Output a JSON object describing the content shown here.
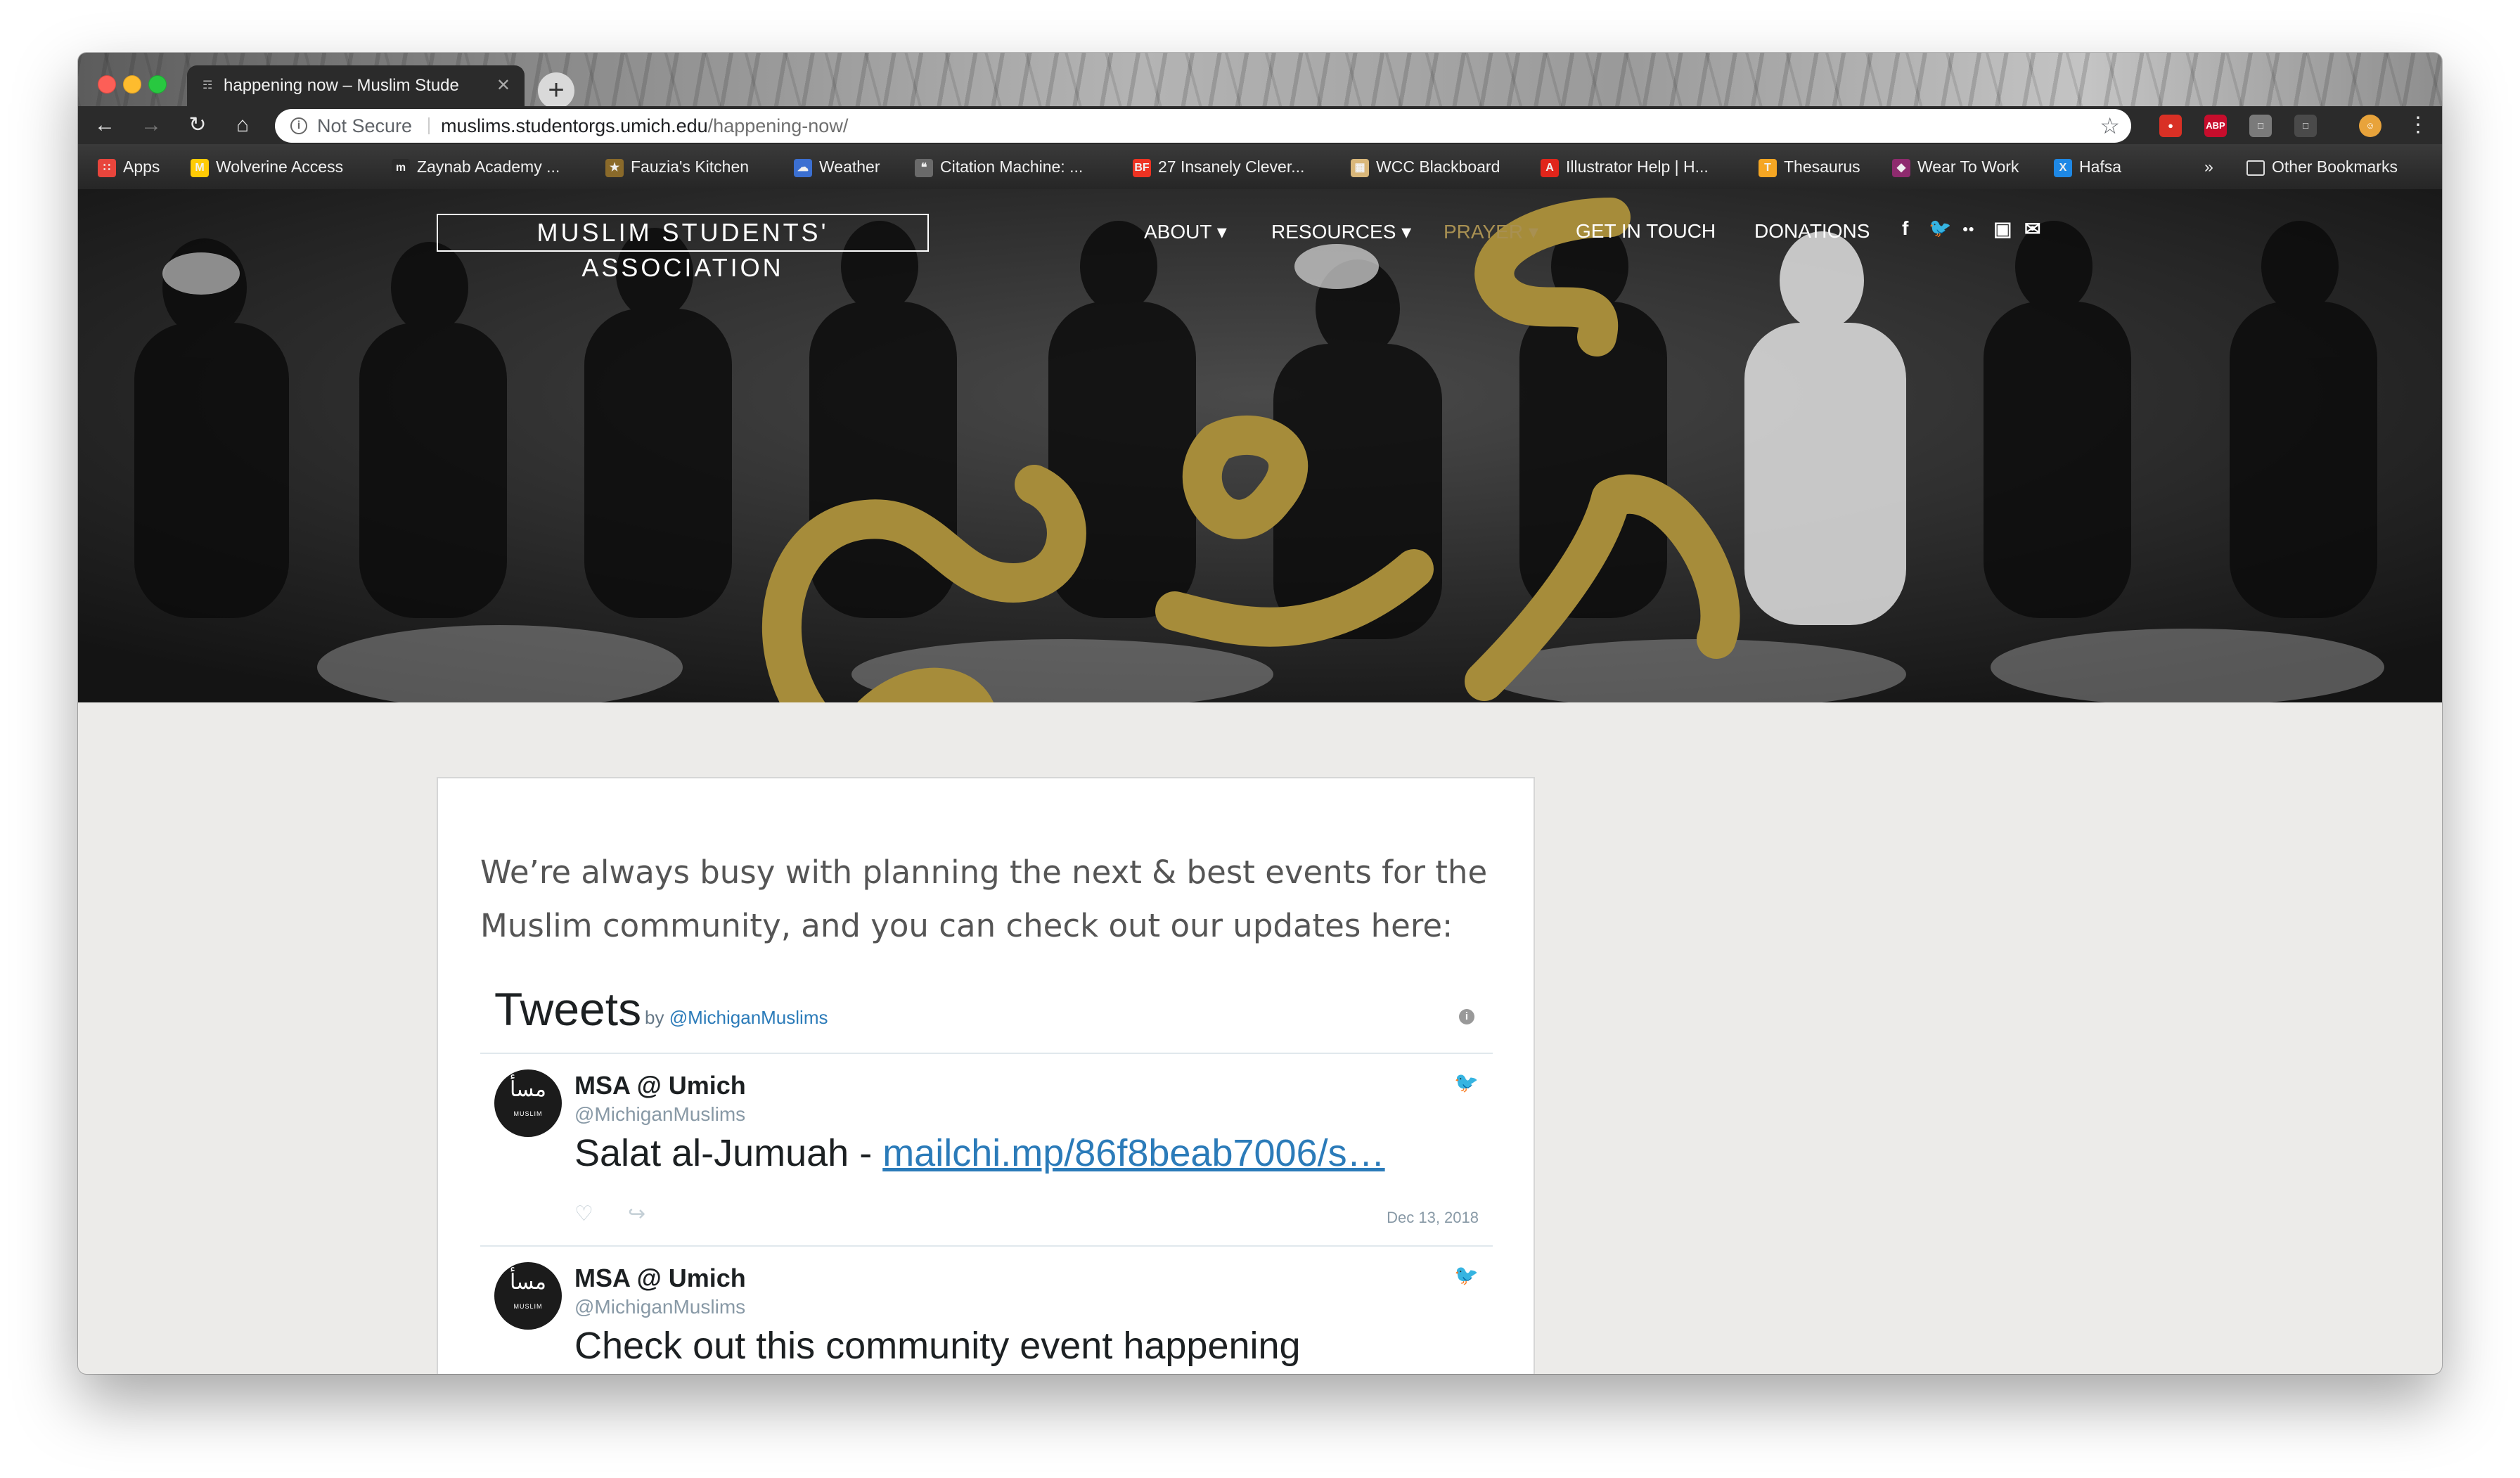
{
  "browser": {
    "tab_title": "happening now – Muslim Stude",
    "tab_favicon_glyph": "☶",
    "close_glyph": "✕",
    "new_tab_glyph": "+",
    "url_security": "Not Secure",
    "url_host": "muslims.studentorgs.umich.edu",
    "url_path": "/happening-now/",
    "buttons": {
      "back": "←",
      "forward": "→",
      "reload": "↻",
      "home": "⌂",
      "bookmark_star": "☆",
      "menu": "⋮"
    },
    "extensions": [
      {
        "label": "●",
        "color": "#d93025"
      },
      {
        "label": "ABP",
        "color": "#c70d2c"
      },
      {
        "label": "□",
        "color": "#7a7a7a"
      },
      {
        "label": "□",
        "color": "#4a4a4a"
      },
      {
        "label": "☺",
        "color": "#e8a33b"
      }
    ]
  },
  "bookmarks": [
    {
      "label": "Apps",
      "icon": "apps-grid-icon",
      "icon_color": "#e8453c",
      "icon_glyph": "∷"
    },
    {
      "label": "Wolverine Access",
      "icon": "michigan-m-icon",
      "icon_color": "#ffcb05",
      "icon_glyph": "M"
    },
    {
      "label": "Zaynab Academy ...",
      "icon": "m-letter-icon",
      "icon_color": "#2b2b2b",
      "icon_glyph": "m"
    },
    {
      "label": "Fauzia's Kitchen",
      "icon": "kitchen-icon",
      "icon_color": "#8a6a2a",
      "icon_glyph": "★"
    },
    {
      "label": "Weather",
      "icon": "weather-icon",
      "icon_color": "#3b6fd1",
      "icon_glyph": "☁"
    },
    {
      "label": "Citation Machine: ...",
      "icon": "citation-icon",
      "icon_color": "#6a6a6a",
      "icon_glyph": "❝"
    },
    {
      "label": "27 Insanely Clever...",
      "icon": "bf-icon",
      "icon_color": "#ee3322",
      "icon_glyph": "BF"
    },
    {
      "label": "WCC Blackboard",
      "icon": "blackboard-icon",
      "icon_color": "#d9b77a",
      "icon_glyph": "▦"
    },
    {
      "label": "Illustrator Help | H...",
      "icon": "adobe-icon",
      "icon_color": "#e1251b",
      "icon_glyph": "A"
    },
    {
      "label": "Thesaurus",
      "icon": "thesaurus-icon",
      "icon_color": "#f5a623",
      "icon_glyph": "T"
    },
    {
      "label": "Wear To Work",
      "icon": "wear-to-work-icon",
      "icon_color": "#8e2b6e",
      "icon_glyph": "◆"
    },
    {
      "label": "Hafsa",
      "icon": "hafsa-icon",
      "icon_color": "#1e88e5",
      "icon_glyph": "X"
    }
  ],
  "bookmarks_overflow": "»",
  "bookmarks_other": "Other Bookmarks",
  "site": {
    "brand": "MUSLIM STUDENTS' ASSOCIATION",
    "nav": [
      "ABOUT ▾",
      "RESOURCES ▾",
      "PRAYER ▾",
      "GET IN TOUCH",
      "DONATIONS"
    ],
    "social": [
      "f",
      "𝕥",
      "●●",
      "▣",
      "✉"
    ],
    "social_names": [
      "facebook-icon",
      "twitter-icon",
      "flickr-icon",
      "instagram-icon",
      "email-icon"
    ],
    "logo_color": "#a68c3a"
  },
  "content": {
    "intro": "We’re always busy with planning the next & best events for the Muslim community, and you can check out our updates here:",
    "tweets_title": "Tweets",
    "tweets_by": "by",
    "tweets_handle": "@MichiganMuslims",
    "info_glyph": "i",
    "tweets": [
      {
        "name": "MSA @ Umich",
        "handle": "@MichiganMuslims",
        "text": "Salat al-Jumuah - ",
        "link": "mailchi.mp/86f8beab7006/s…",
        "date": "Dec 13, 2018",
        "avatar_glyph": "مسأ",
        "avatar_word": "MUSLIM"
      },
      {
        "name": "MSA @ Umich",
        "handle": "@MichiganMuslims",
        "text": "Check out this community event happening",
        "link": "",
        "date": "",
        "avatar_glyph": "مسأ",
        "avatar_word": "MUSLIM"
      }
    ],
    "icons": {
      "bird": "🐦",
      "heart": "♡",
      "share": "↪"
    }
  }
}
